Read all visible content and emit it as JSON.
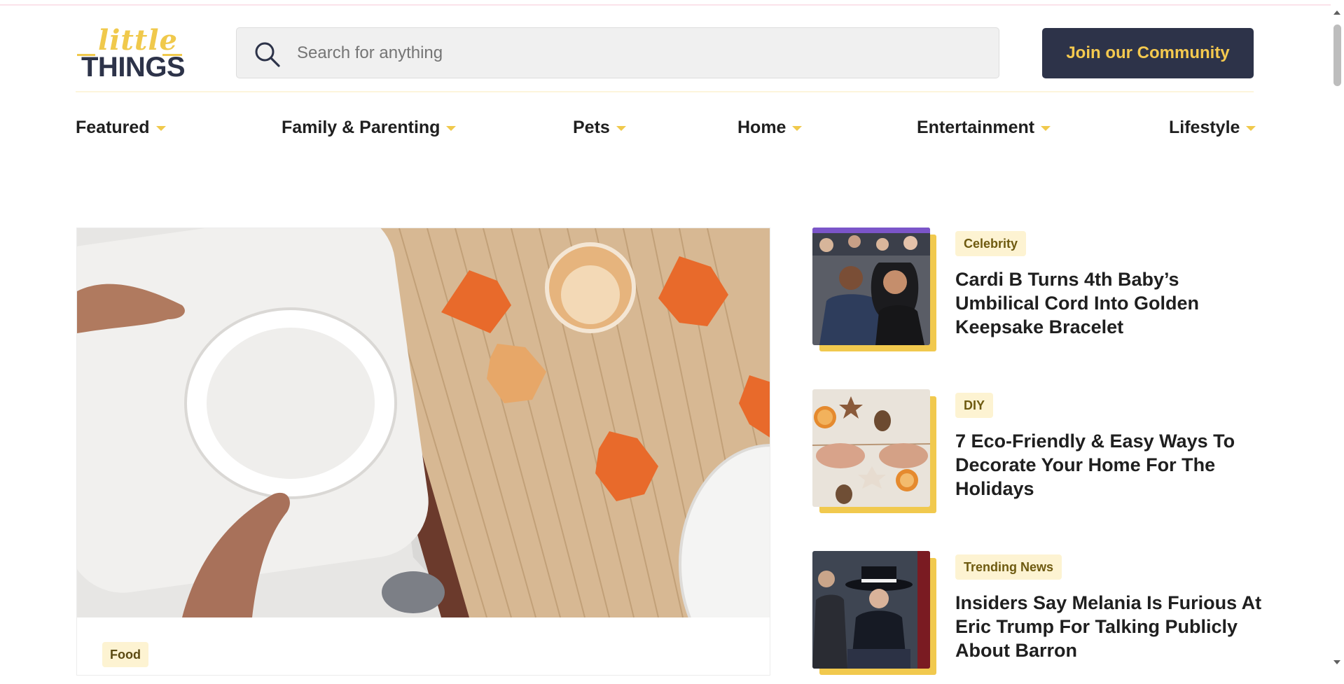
{
  "header": {
    "logo_small": "little",
    "logo_big": "THINGS",
    "search_placeholder": "Search for anything",
    "join_label": "Join our Community"
  },
  "nav": {
    "items": [
      {
        "label": "Featured"
      },
      {
        "label": "Family & Parenting"
      },
      {
        "label": "Pets"
      },
      {
        "label": "Home"
      },
      {
        "label": "Entertainment"
      },
      {
        "label": "Lifestyle"
      }
    ]
  },
  "featured": {
    "tag": "Food"
  },
  "stories": [
    {
      "tag": "Celebrity",
      "title": "Cardi B Turns 4th Baby’s Umbilical Cord Into Golden Keepsake Bracelet"
    },
    {
      "tag": "DIY",
      "title": "7 Eco-Friendly & Easy Ways To Decorate Your Home For The Holidays"
    },
    {
      "tag": "Trending News",
      "title": "Insiders Say Melania Is Furious At Eric Trump For Talking Publicly About Barron"
    }
  ],
  "colors": {
    "brand_yellow": "#f0c94c",
    "brand_navy": "#2d3349",
    "tag_bg": "#fdf3d2"
  }
}
